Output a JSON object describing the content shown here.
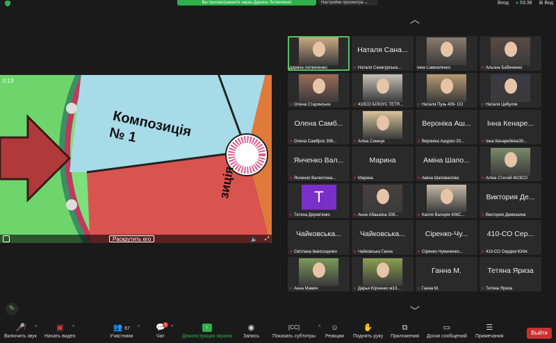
{
  "topbar": {
    "banner": "Вы просматриваете экран Дарина Литвиченко",
    "view_options": "Настройки просмотра ⌄",
    "enter": "Вход",
    "time": "53:38",
    "view": "Вид"
  },
  "share": {
    "timestamp": "0:13",
    "wheel_segment_1": "Композиція",
    "wheel_segment_1_num": "№ 1",
    "wheel_segment_2": "зиція",
    "spin_button": "Раскрутить его"
  },
  "participants": [
    {
      "big": "",
      "label": "Дарина Литвиченко",
      "video": "woman-blonde",
      "active": true,
      "muted": false
    },
    {
      "big": "Наталя Сана...",
      "label": "Наталя Санагурська...",
      "video": "",
      "muted": true
    },
    {
      "big": "",
      "label": "Інна Самойленко",
      "video": "woman-dark",
      "muted": false
    },
    {
      "big": "",
      "label": "Альона Бабиненко",
      "video": "woman-dark2",
      "muted": true
    },
    {
      "big": "",
      "label": "Олена Старинська",
      "video": "woman-red",
      "muted": true
    },
    {
      "big": "",
      "label": "410СО БІЛОУС ТЕТЯ...",
      "video": "room",
      "muted": true
    },
    {
      "big": "",
      "label": "Наталя Пузь 409- СО",
      "video": "woman-blonde2",
      "muted": true
    },
    {
      "big": "",
      "label": "Наталя Цибуляк",
      "video": "woman-black",
      "muted": true
    },
    {
      "big": "Олена Самб...",
      "label": "Олена Самброс 306...",
      "video": "",
      "muted": true
    },
    {
      "big": "",
      "label": "Аліна Синиця",
      "video": "outdoor",
      "muted": true
    },
    {
      "big": "Вероніка Аш...",
      "label": "Вероніка Ашурко 20...",
      "video": "",
      "muted": true
    },
    {
      "big": "Інна Кенаре...",
      "label": "Інна Кенарейкіна30...",
      "video": "",
      "muted": true
    },
    {
      "big": "Янченко Вал...",
      "label": "Янченко Валентина...",
      "video": "",
      "muted": true
    },
    {
      "big": "Марина",
      "label": "Марина",
      "video": "",
      "muted": true
    },
    {
      "big": "Аміна Шапо...",
      "label": "Аміна Шаповалова",
      "video": "",
      "muted": true
    },
    {
      "big": "",
      "label": "Аліна Стегній М23СО",
      "video": "woman-room",
      "muted": true
    },
    {
      "big": "",
      "label": "Тетяна Дерев'янко",
      "video": "avatar-T",
      "muted": true
    },
    {
      "big": "",
      "label": "Анна Абашкіна 308...",
      "video": "woman-black2",
      "muted": true
    },
    {
      "big": "",
      "label": "Капля Валерія 408С...",
      "video": "woman-room2",
      "muted": true
    },
    {
      "big": "Виктория Де...",
      "label": "Виктория Демешина",
      "video": "",
      "muted": true
    },
    {
      "big": "Чайковська...",
      "label": "Світлана Івансощенко",
      "video": "",
      "muted": true
    },
    {
      "big": "Чайковська...",
      "label": "Чайковська Ганна",
      "video": "",
      "muted": true
    },
    {
      "big": "Сіренко-Чу...",
      "label": "Сіренко-Чумаченко...",
      "video": "",
      "muted": true
    },
    {
      "big": "410-СО Сер...",
      "label": "410-СО Сердюк Юлія",
      "video": "",
      "muted": true
    },
    {
      "big": "",
      "label": "Анна Мамич",
      "video": "woman-outdoor",
      "muted": true
    },
    {
      "big": "",
      "label": "Дарья Юрченко м13...",
      "video": "woman-outdoor2",
      "muted": true
    },
    {
      "big": "Ганна М.",
      "label": "Ганна М.",
      "video": "",
      "muted": true
    },
    {
      "big": "Тетяна Яриза",
      "label": "Тетяна Яриза",
      "video": "",
      "muted": true
    }
  ],
  "toolbar": {
    "audio": "Включить звук",
    "video": "Начать видео",
    "participants": "Участники",
    "participants_count": "67",
    "chat": "Чат",
    "chat_badge": "3",
    "share": "Демонстрация экрана",
    "record": "Запись",
    "captions": "Показать субтитры",
    "reactions": "Реакции",
    "raise_hand": "Поднять руку",
    "apps": "Приложения",
    "whiteboards": "Доски сообщений",
    "notes": "Примечания",
    "leave": "Выйти"
  },
  "colors": {
    "accent_green": "#2fb04a",
    "leave_red": "#c8312f",
    "tile_bg": "#2a2a2a",
    "mute_red": "#e03a3a"
  }
}
